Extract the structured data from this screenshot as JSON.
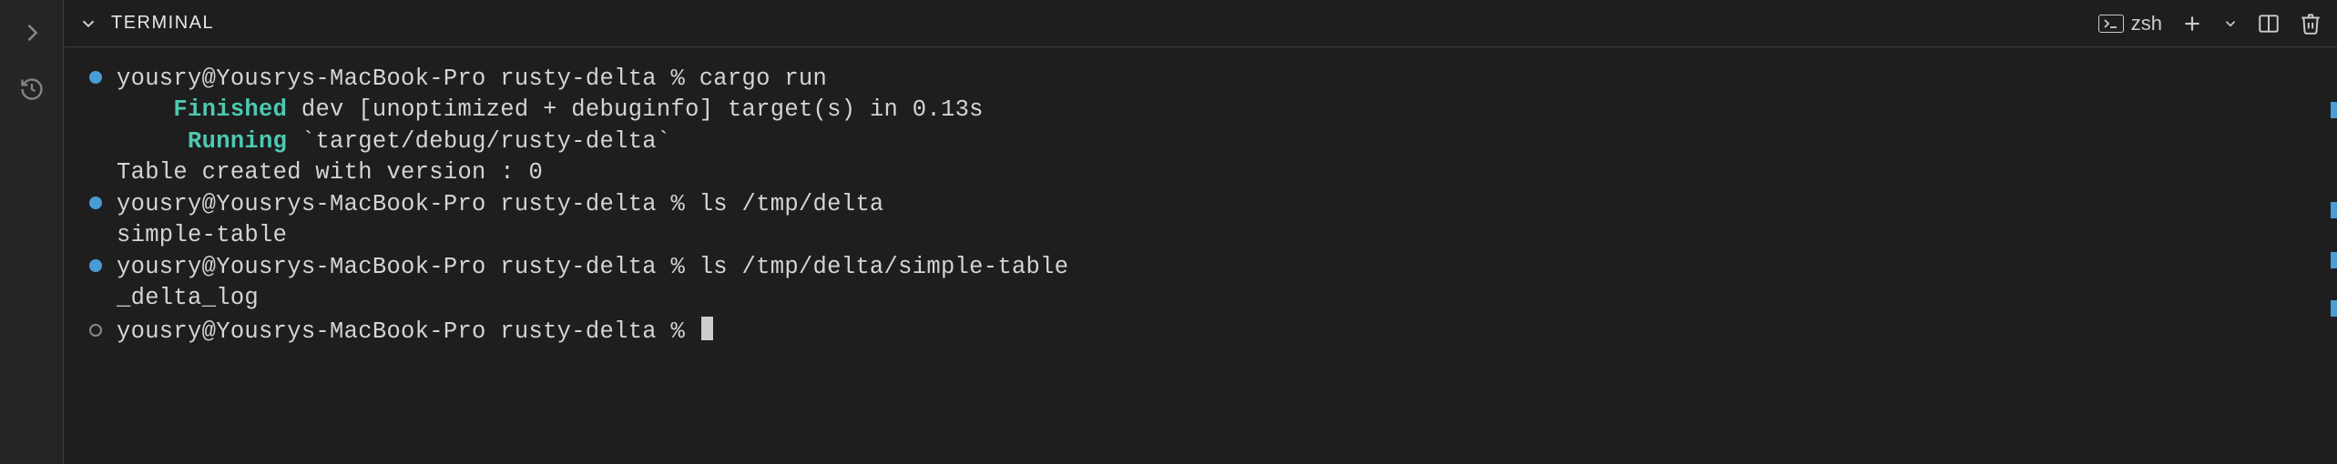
{
  "panel": {
    "title": "TERMINAL",
    "shell_name": "zsh"
  },
  "terminal": {
    "lines": [
      {
        "bullet": "filled",
        "segments": [
          {
            "t": "yousry@Yousrys-MacBook-Pro rusty-delta % cargo run"
          }
        ]
      },
      {
        "bullet": "none",
        "indent": 4,
        "segments": [
          {
            "t": "Finished",
            "cls": "green"
          },
          {
            "t": " dev [unoptimized + debuginfo] target(s) in 0.13s"
          }
        ]
      },
      {
        "bullet": "none",
        "indent": 5,
        "segments": [
          {
            "t": "Running",
            "cls": "green"
          },
          {
            "t": " `target/debug/rusty-delta`"
          }
        ]
      },
      {
        "bullet": "none",
        "indent": 0,
        "segments": [
          {
            "t": "Table created with version : 0"
          }
        ]
      },
      {
        "bullet": "filled",
        "segments": [
          {
            "t": "yousry@Yousrys-MacBook-Pro rusty-delta % ls /tmp/delta"
          }
        ]
      },
      {
        "bullet": "none",
        "indent": 0,
        "segments": [
          {
            "t": "simple-table"
          }
        ]
      },
      {
        "bullet": "filled",
        "segments": [
          {
            "t": "yousry@Yousrys-MacBook-Pro rusty-delta % ls /tmp/delta/simple-table"
          }
        ]
      },
      {
        "bullet": "none",
        "indent": 0,
        "segments": [
          {
            "t": "_delta_log"
          }
        ]
      },
      {
        "bullet": "hollow",
        "segments": [
          {
            "t": "yousry@Yousrys-MacBook-Pro rusty-delta % "
          }
        ],
        "cursor": true
      }
    ]
  },
  "scroll_marks": [
    60,
    170,
    225,
    278
  ]
}
